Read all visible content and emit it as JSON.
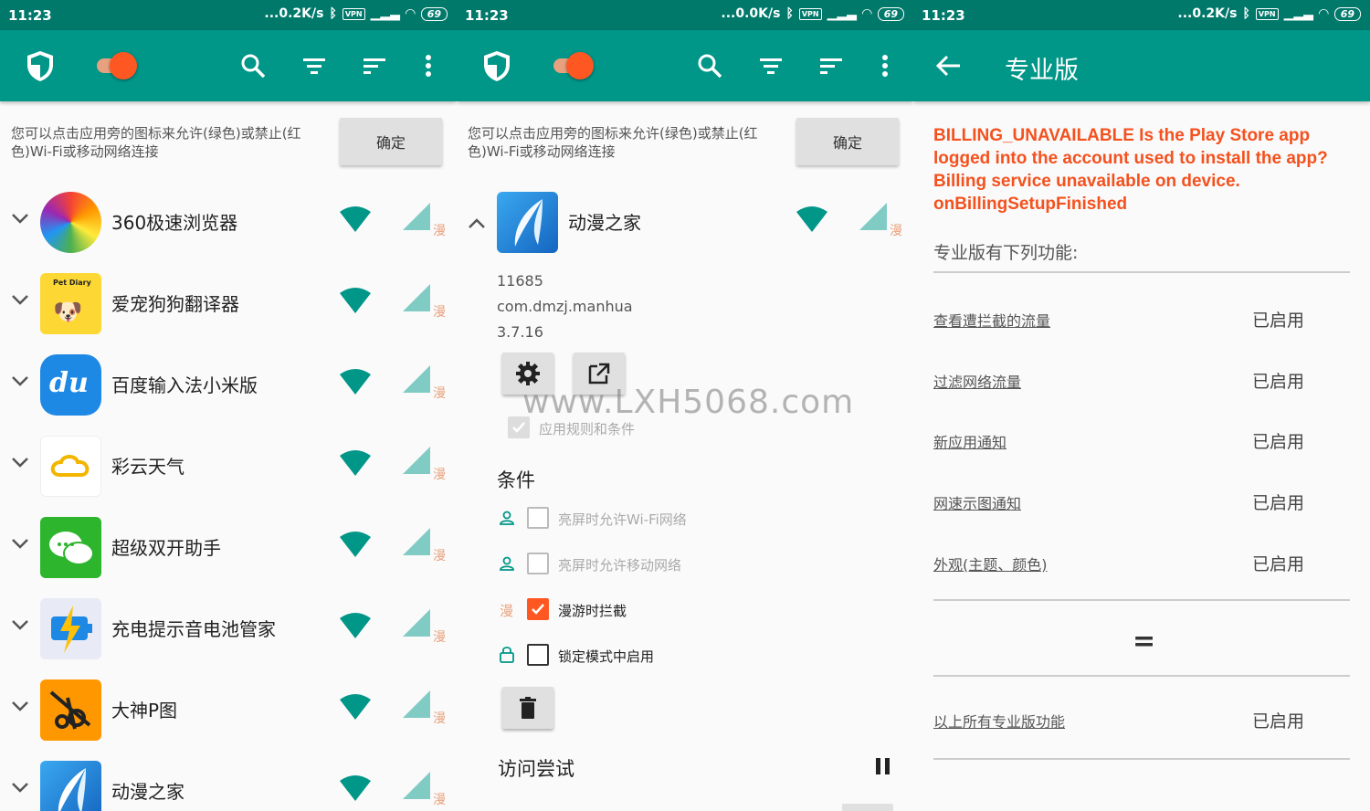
{
  "status": {
    "time": "11:23",
    "p1_speed": "...0.2K/s",
    "p2_speed": "...0.0K/s",
    "p3_speed": "...0.2K/s",
    "vpn": "VPN",
    "battery": "69"
  },
  "hint": {
    "text": "您可以点击应用旁的图标来允许(绿色)或禁止(红色)Wi-Fi或移动网络连接",
    "ok_label": "确定"
  },
  "roam_label": "漫",
  "apps": [
    {
      "name": "360极速浏览器"
    },
    {
      "name": "爱宠狗狗翻译器",
      "icon_text": "Pet Diary"
    },
    {
      "name": "百度输入法小米版",
      "icon_text": "du"
    },
    {
      "name": "彩云天气"
    },
    {
      "name": "超级双开助手"
    },
    {
      "name": "充电提示音电池管家"
    },
    {
      "name": "大神P图"
    },
    {
      "name": "动漫之家"
    }
  ],
  "detail": {
    "app_name": "动漫之家",
    "uid": "11685",
    "package": "com.dmzj.manhua",
    "version": "3.7.16",
    "apply_rules": "应用规则和条件",
    "conditions_title": "条件",
    "conditions": [
      {
        "label": "亮屏时允许Wi-Fi网络",
        "checked": false
      },
      {
        "label": "亮屏时允许移动网络",
        "checked": false
      },
      {
        "label": "漫游时拦截",
        "checked": true
      },
      {
        "label": "锁定模式中启用",
        "checked": false
      }
    ],
    "access_title": "访问尝试"
  },
  "watermark": "www.LXH5068.com",
  "pro": {
    "title": "专业版",
    "error": "BILLING_UNAVAILABLE Is the Play Store app logged into the account used to install the app? Billing service unavailable on device. onBillingSetupFinished",
    "heading": "专业版有下列功能:",
    "features": [
      {
        "label": "查看遭拦截的流量",
        "status": "已启用"
      },
      {
        "label": "过滤网络流量",
        "status": "已启用"
      },
      {
        "label": "新应用通知",
        "status": "已启用"
      },
      {
        "label": "网速示图通知",
        "status": "已启用"
      },
      {
        "label": "外观(主题、颜色)",
        "status": "已启用"
      }
    ],
    "equals": "=",
    "all_features": {
      "label": "以上所有专业版功能",
      "status": "已启用"
    }
  },
  "colors": {
    "status_bar": "#00796b",
    "toolbar": "#009688",
    "accent": "#ff5722",
    "error": "#f4511e"
  }
}
